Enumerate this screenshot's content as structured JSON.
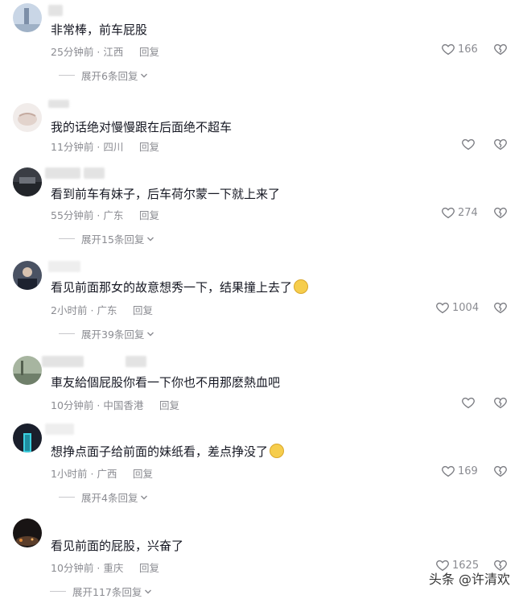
{
  "comments": [
    {
      "text": "非常棒，前车屁股",
      "time": "25分钟前",
      "location": "江西",
      "reply_label": "回复",
      "likes": "166",
      "expand": "展开6条回复"
    },
    {
      "text": "我的话绝对慢慢跟在后面绝不超车",
      "time": "11分钟前",
      "location": "四川",
      "reply_label": "回复",
      "likes": "",
      "expand": ""
    },
    {
      "text": "看到前车有妹子，后车荷尔蒙一下就上来了",
      "time": "55分钟前",
      "location": "广东",
      "reply_label": "回复",
      "likes": "274",
      "expand": "展开15条回复"
    },
    {
      "text": "看见前面那女的故意想秀一下，结果撞上去了",
      "time": "2小时前",
      "location": "广东",
      "reply_label": "回复",
      "likes": "1004",
      "expand": "展开39条回复"
    },
    {
      "text": "車友給個屁股你看一下你也不用那麽熱血吧",
      "time": "10分钟前",
      "location": "中国香港",
      "reply_label": "回复",
      "likes": "",
      "expand": ""
    },
    {
      "text": "想挣点面子给前面的妹纸看，差点挣没了",
      "time": "1小时前",
      "location": "广西",
      "reply_label": "回复",
      "likes": "169",
      "expand": "展开4条回复"
    },
    {
      "text": "看见前面的屁股，兴奋了",
      "time": "10分钟前",
      "location": "重庆",
      "reply_label": "回复",
      "likes": "1625",
      "expand": "展开117条回复"
    }
  ],
  "icons": {
    "like": "heart-icon",
    "dislike": "broken-heart-icon",
    "expand": "chevron-down-icon"
  },
  "watermark": "头条 @许清欢"
}
